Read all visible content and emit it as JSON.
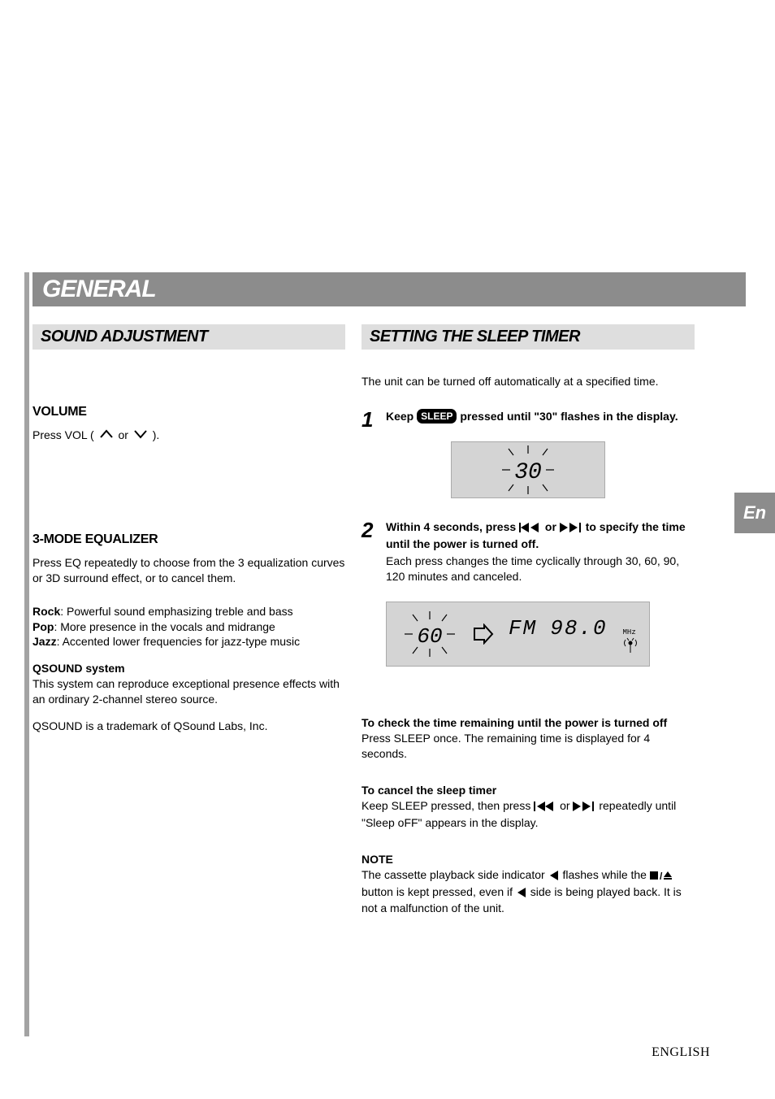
{
  "header": {
    "title": "GENERAL"
  },
  "sound_adjustment": {
    "title": "SOUND ADJUSTMENT",
    "volume": {
      "heading": "VOLUME",
      "text_prefix": "Press VOL (",
      "text_or": " or ",
      "text_suffix": ")."
    },
    "equalizer": {
      "heading": "3-MODE EQUALIZER",
      "intro": "Press EQ repeatedly to choose from the 3 equalization curves or 3D surround effect, or to cancel them.",
      "rock_label": "Rock",
      "rock_text": ": Powerful sound emphasizing treble and bass",
      "pop_label": "Pop",
      "pop_text": ": More presence in the vocals and midrange",
      "jazz_label": "Jazz",
      "jazz_text": ": Accented lower frequencies for jazz-type music",
      "qsound_label": "QSOUND system",
      "qsound_text1": "This system can reproduce exceptional presence effects with an ordinary 2-channel stereo source.",
      "qsound_text2": "QSOUND is a trademark of QSound Labs, Inc."
    }
  },
  "sleep_timer": {
    "title": "SETTING THE SLEEP TIMER",
    "intro": "The unit can be turned off automatically at a specified time.",
    "step1": {
      "num": "1",
      "text_prefix": "Keep ",
      "sleep_label": "SLEEP",
      "text_suffix": " pressed until \"30\" flashes in the display.",
      "display_value": "30"
    },
    "step2": {
      "num": "2",
      "text_prefix": "Within 4 seconds, press ",
      "text_or": " or ",
      "text_suffix": " to specify the time until the power is turned off.",
      "body": "Each press changes the time cyclically through 30, 60, 90, 120 minutes and canceled.",
      "display_timer": "60",
      "display_band": "FM",
      "display_freq": "98.0",
      "display_unit": "MHz"
    },
    "check_heading": "To check the time remaining until the power is turned off",
    "check_body": "Press SLEEP once. The remaining time is displayed for 4 seconds.",
    "cancel_heading": "To cancel the sleep timer",
    "cancel_body_prefix": "Keep SLEEP pressed, then press ",
    "cancel_body_or": " or ",
    "cancel_body_suffix": " repeatedly until \"Sleep oFF\" appears in the display.",
    "note_heading": "NOTE",
    "note_body_prefix": "The cassette playback side indicator ",
    "note_body_mid1": " flashes while the ",
    "note_body_mid2": " button is kept pressed, even if ",
    "note_body_suffix": " side is being played back. It is not a malfunction of the unit."
  },
  "tab": {
    "label": "En"
  },
  "footer": {
    "language": "ENGLISH"
  }
}
